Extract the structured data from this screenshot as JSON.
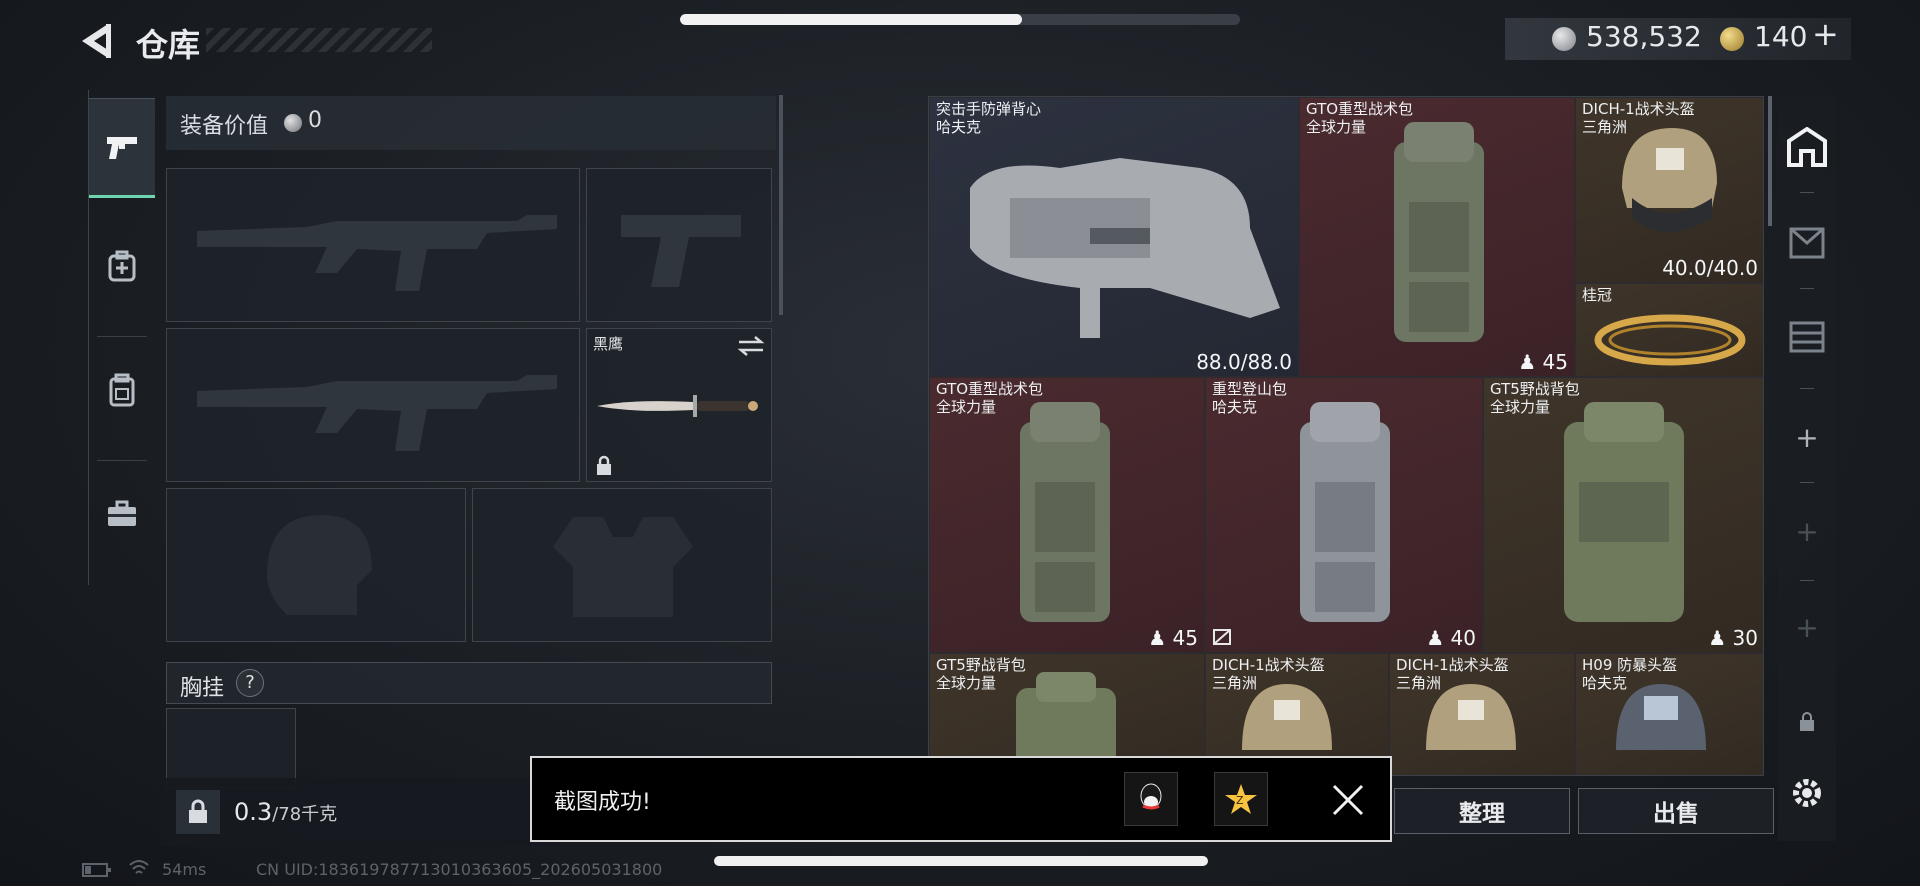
{
  "header": {
    "title": "仓库",
    "money": "538,532",
    "gold": "140",
    "plus": "+"
  },
  "top_progress": {
    "fraction": 0.61
  },
  "equipment": {
    "value_label": "装备价值",
    "value": "0",
    "knife_name": "黑鹰",
    "chest_label": "胸挂",
    "chest_help": "?",
    "weight_current": "0.3",
    "weight_max": "/78千克"
  },
  "inventory": {
    "items": [
      {
        "name": "突击手防弹背心",
        "brand": "哈夫克",
        "value": "88.0/88.0"
      },
      {
        "name": "GTO重型战术包",
        "brand": "全球力量",
        "value": "45"
      },
      {
        "name": "DICH-1战术头盔",
        "brand": "三角洲",
        "value": "40.0/40.0"
      },
      {
        "name": "桂冠",
        "brand": "",
        "value": ""
      },
      {
        "name": "GTO重型战术包",
        "brand": "全球力量",
        "value": "45"
      },
      {
        "name": "重型登山包",
        "brand": "哈夫克",
        "value": "40"
      },
      {
        "name": "GT5野战背包",
        "brand": "全球力量",
        "value": "30"
      },
      {
        "name": "GT5野战背包",
        "brand": "全球力量",
        "value": ""
      },
      {
        "name": "DICH-1战术头盔",
        "brand": "三角洲",
        "value": ""
      },
      {
        "name": "DICH-1战术头盔",
        "brand": "三角洲",
        "value": ""
      },
      {
        "name": "H09 防暴头盔",
        "brand": "哈夫克",
        "value": ""
      }
    ]
  },
  "buttons": {
    "sort": "整理",
    "sell": "出售"
  },
  "toast": {
    "message": "截图成功!"
  },
  "status": {
    "ping": "54ms",
    "uid": "CN UID:18361978771301036360​5_202605031800"
  },
  "colors": {
    "accent": "#6fd4b0",
    "red_cell": "#4a2a2f",
    "blue_cell": "#2d3240",
    "gold_cell": "#3f352a"
  },
  "icons": [
    "back-icon",
    "pistol-icon",
    "medkit-icon",
    "backpack-icon",
    "briefcase-icon",
    "swap-icon",
    "lock-icon",
    "safehouse-icon",
    "settings-icon",
    "close-icon",
    "qq-icon",
    "qzone-icon",
    "battery-icon",
    "wifi-icon"
  ]
}
